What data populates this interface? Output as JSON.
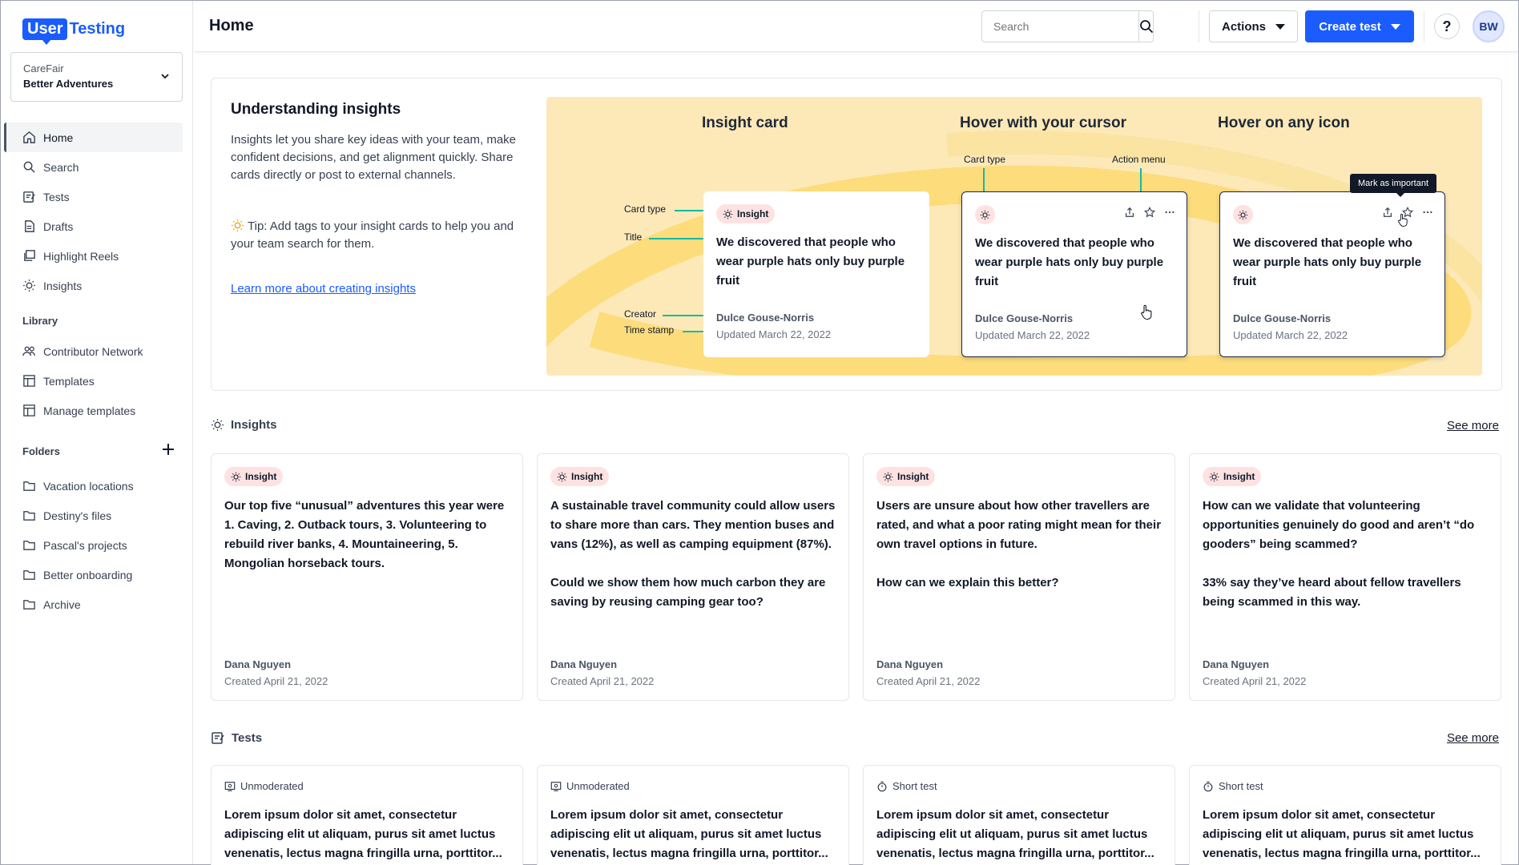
{
  "brand": {
    "logo_part1": "User",
    "logo_part2": "Testing",
    "accent": "#1a5cff"
  },
  "workspace": {
    "org": "CareFair",
    "name": "Better Adventures"
  },
  "nav": {
    "items": [
      {
        "label": "Home",
        "icon": "home-icon"
      },
      {
        "label": "Search",
        "icon": "search-icon"
      },
      {
        "label": "Tests",
        "icon": "tests-icon"
      },
      {
        "label": "Drafts",
        "icon": "drafts-icon"
      },
      {
        "label": "Highlight Reels",
        "icon": "highlight-reels-icon"
      },
      {
        "label": "Insights",
        "icon": "lightbulb-icon"
      }
    ],
    "library_label": "Library",
    "library": [
      {
        "label": "Contributor Network",
        "icon": "people-icon"
      },
      {
        "label": "Templates",
        "icon": "template-icon"
      },
      {
        "label": "Manage templates",
        "icon": "template-icon"
      }
    ],
    "folders_label": "Folders",
    "folders": [
      {
        "label": "Vacation locations"
      },
      {
        "label": "Destiny's files"
      },
      {
        "label": "Pascal's projects"
      },
      {
        "label": "Better onboarding"
      },
      {
        "label": "Archive"
      }
    ]
  },
  "header": {
    "title": "Home",
    "search_placeholder": "Search",
    "actions_label": "Actions",
    "create_label": "Create test",
    "help_label": "?",
    "avatar_initials": "BW"
  },
  "info": {
    "title": "Understanding insights",
    "body": "Insights let you share key ideas with your team, make confident decisions, and get alignment quickly. Share cards directly or post to external channels.",
    "tip": "Tip: Add tags to your insight cards to help you and your team search for them.",
    "link": "Learn more about creating insights",
    "illustration": {
      "heading1": "Insight card",
      "heading2": "Hover with your cursor",
      "heading3": "Hover on any icon",
      "ann_card_type": "Card type",
      "ann_title": "Title",
      "ann_creator": "Creator",
      "ann_timestamp": "Time stamp",
      "ann_card_type2": "Card type",
      "ann_action_menu": "Action menu",
      "tooltip": "Mark as important",
      "card": {
        "type": "Insight",
        "title": "We discovered that people who wear purple hats only buy purple fruit",
        "author": "Dulce Gouse-Norris",
        "date": "Updated March 22, 2022"
      }
    }
  },
  "insights": {
    "label": "Insights",
    "see_more": "See more",
    "cards": [
      {
        "type": "Insight",
        "paras": [
          "Our top five “unusual” adventures this year were 1. Caving, 2. Outback tours, 3. Volunteering to rebuild river banks, 4. Mountaineering, 5. Mongolian horseback tours."
        ],
        "author": "Dana Nguyen",
        "date": "Created April 21, 2022"
      },
      {
        "type": "Insight",
        "paras": [
          "A sustainable travel community could allow users to share more than cars. They mention buses and vans (12%), as well as camping equipment (87%).",
          "Could we show them how much carbon they are saving by reusing camping gear too?"
        ],
        "author": "Dana Nguyen",
        "date": "Created April 21, 2022"
      },
      {
        "type": "Insight",
        "paras": [
          "Users are unsure about how other travellers are rated, and what a poor rating might mean for their own travel options in future.",
          "How can we explain this better?"
        ],
        "author": "Dana Nguyen",
        "date": "Created April 21, 2022"
      },
      {
        "type": "Insight",
        "paras": [
          "How can we validate that volunteering opportunities genuinely do good and aren’t “do gooders” being scammed?",
          "33% say they’ve heard about fellow travellers being scammed in this way."
        ],
        "author": "Dana Nguyen",
        "date": "Created April 21, 2022"
      }
    ]
  },
  "tests": {
    "label": "Tests",
    "see_more": "See more",
    "cards": [
      {
        "type": "Unmoderated",
        "icon": "unmoderated-icon",
        "title": "Lorem ipsum dolor sit amet, consectetur adipiscing elit ut aliquam, purus sit amet luctus venenatis, lectus magna fringilla urna, porttitor..."
      },
      {
        "type": "Unmoderated",
        "icon": "unmoderated-icon",
        "title": "Lorem ipsum dolor sit amet, consectetur adipiscing elit ut aliquam, purus sit amet luctus venenatis, lectus magna fringilla urna, porttitor..."
      },
      {
        "type": "Short test",
        "icon": "stopwatch-icon",
        "title": "Lorem ipsum dolor sit amet, consectetur adipiscing elit ut aliquam, purus sit amet luctus venenatis, lectus magna fringilla urna, porttitor..."
      },
      {
        "type": "Short test",
        "icon": "stopwatch-icon",
        "title": "Lorem ipsum dolor sit amet, consectetur adipiscing elit ut aliquam, purus sit amet luctus venenatis, lectus magna fringilla urna, porttitor..."
      }
    ]
  }
}
